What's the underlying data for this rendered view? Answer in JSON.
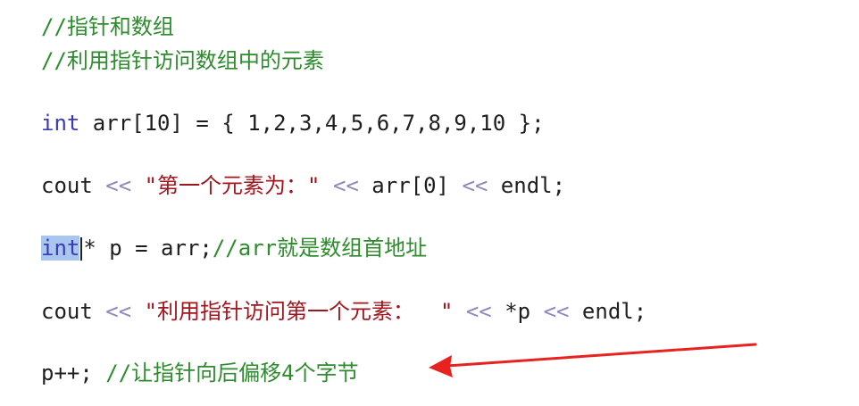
{
  "code": {
    "line1": "//指针和数组",
    "line2": "//利用指针访问数组中的元素",
    "line3": {
      "kw": "int",
      "rest": " arr[10] = { 1,2,3,4,5,6,7,8,9,10 };"
    },
    "line4": {
      "a": "cout ",
      "op1": "<<",
      "str": " \"第一个元素为：\" ",
      "op2": "<<",
      "b": " arr[0] ",
      "op3": "<<",
      "c": " endl;"
    },
    "line5": {
      "kw": "int",
      "code": "* p = arr;",
      "comment": "//arr就是数组首地址"
    },
    "line6": {
      "a": "cout ",
      "op1": "<<",
      "str": " \"利用指针访问第一个元素：  \" ",
      "op2": "<<",
      "b": " *p ",
      "op3": "<<",
      "c": " endl;"
    },
    "line7": {
      "code": "p++; ",
      "comment": "//让指针向后偏移4个字节"
    }
  },
  "annotation": {
    "arrow_color": "#e8231f"
  }
}
